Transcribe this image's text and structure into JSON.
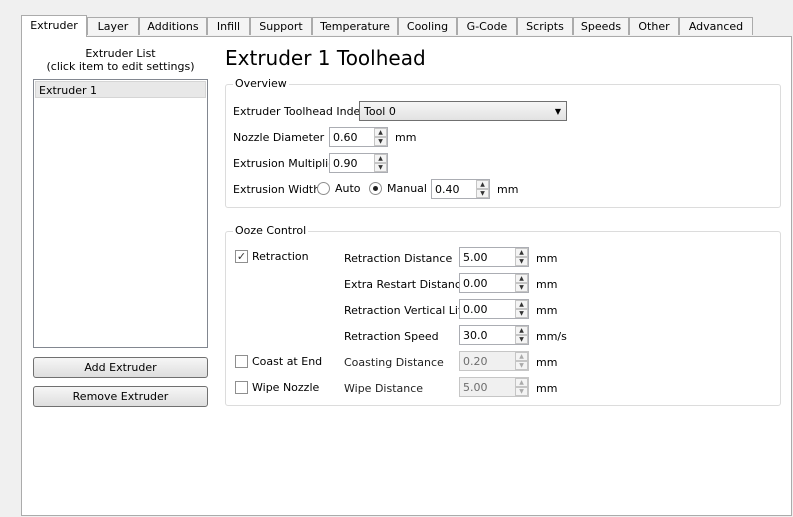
{
  "tabs": [
    {
      "label": "Extruder"
    },
    {
      "label": "Layer"
    },
    {
      "label": "Additions"
    },
    {
      "label": "Infill"
    },
    {
      "label": "Support"
    },
    {
      "label": "Temperature"
    },
    {
      "label": "Cooling"
    },
    {
      "label": "G-Code"
    },
    {
      "label": "Scripts"
    },
    {
      "label": "Speeds"
    },
    {
      "label": "Other"
    },
    {
      "label": "Advanced"
    }
  ],
  "active_tab": "Extruder",
  "sidebar": {
    "list_title_line1": "Extruder List",
    "list_title_line2": "(click item to edit settings)",
    "items": [
      {
        "label": "Extruder 1"
      }
    ],
    "add_button": "Add Extruder",
    "remove_button": "Remove Extruder"
  },
  "main": {
    "title": "Extruder 1 Toolhead",
    "overview": {
      "title": "Overview",
      "toolhead_index_label": "Extruder Toolhead Index",
      "toolhead_index_value": "Tool 0",
      "nozzle_diameter_label": "Nozzle Diameter",
      "nozzle_diameter_value": "0.60",
      "nozzle_diameter_unit": "mm",
      "extrusion_multiplier_label": "Extrusion Multiplier",
      "extrusion_multiplier_value": "0.90",
      "extrusion_width_label": "Extrusion Width",
      "auto_label": "Auto",
      "manual_label": "Manual",
      "extrusion_width_value": "0.40",
      "extrusion_width_unit": "mm"
    },
    "ooze": {
      "title": "Ooze Control",
      "retraction_label": "Retraction",
      "coast_label": "Coast at End",
      "wipe_label": "Wipe Nozzle",
      "retraction_distance_label": "Retraction Distance",
      "retraction_distance_value": "5.00",
      "extra_restart_label": "Extra Restart Distance",
      "extra_restart_value": "0.00",
      "vertical_lift_label": "Retraction Vertical Lift",
      "vertical_lift_value": "0.00",
      "retraction_speed_label": "Retraction Speed",
      "retraction_speed_value": "30.0",
      "retraction_speed_unit": "mm/s",
      "coasting_distance_label": "Coasting Distance",
      "coasting_distance_value": "0.20",
      "wipe_distance_label": "Wipe Distance",
      "wipe_distance_value": "5.00",
      "mm": "mm"
    }
  }
}
